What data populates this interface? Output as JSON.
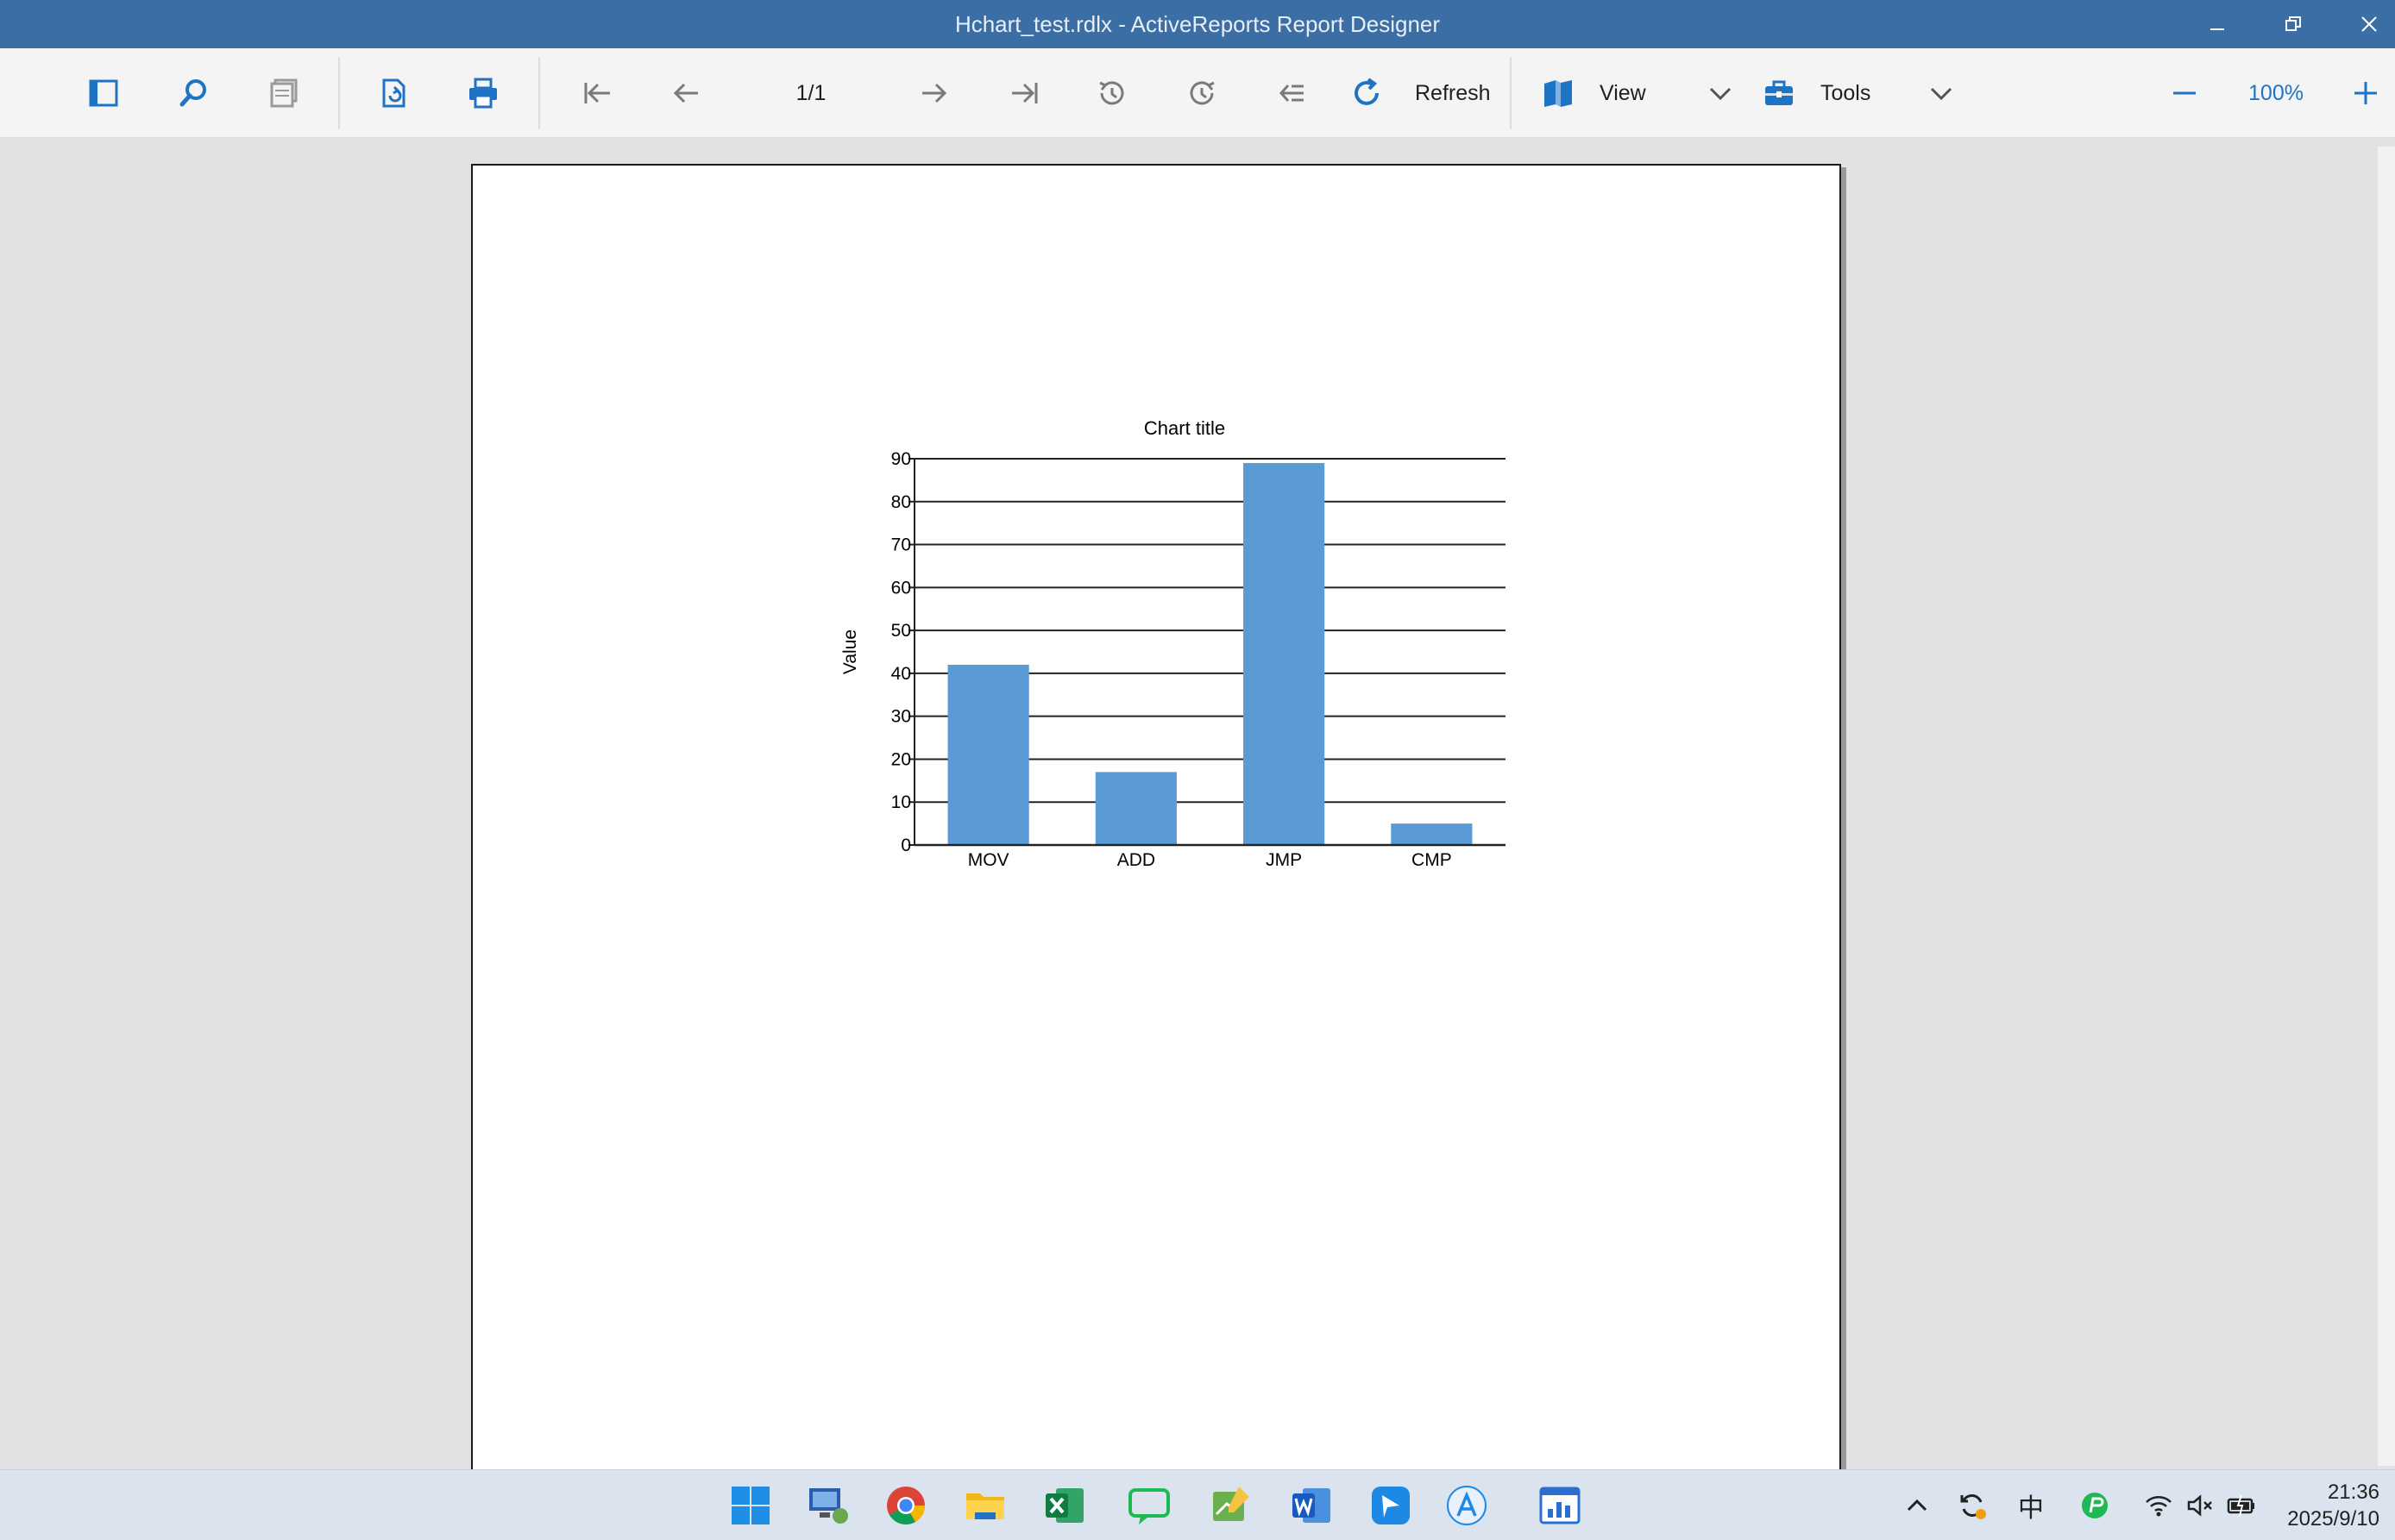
{
  "window": {
    "title": "Hchart_test.rdlx - ActiveReports Report Designer",
    "controls": [
      "minimize-icon",
      "restore-icon",
      "close-icon"
    ]
  },
  "toolbar": {
    "page_indicator": "1/1",
    "refresh_label": "Refresh",
    "view_label": "View",
    "tools_label": "Tools",
    "zoom_label": "100%",
    "icons": [
      "sidebar-toggle-icon",
      "search-icon",
      "pages-icon",
      "page-setup-icon",
      "print-icon",
      "first-page-icon",
      "previous-page-icon",
      "next-page-icon",
      "last-page-icon",
      "history-back-icon",
      "history-forward-icon",
      "back-to-parent-icon",
      "refresh-icon",
      "view-icon",
      "tools-icon",
      "zoom-out-icon",
      "zoom-in-icon"
    ],
    "accent_color": "#1f73c5"
  },
  "chart_data": {
    "type": "bar",
    "title": "Chart title",
    "xlabel": "",
    "ylabel": "Value",
    "categories": [
      "MOV",
      "ADD",
      "JMP",
      "CMP"
    ],
    "values": [
      42,
      17,
      89,
      5
    ],
    "ylim": [
      0,
      90
    ],
    "yticks": [
      "0",
      "10",
      "20",
      "30",
      "40",
      "50",
      "60",
      "70",
      "80",
      "90"
    ],
    "grid": true,
    "bar_color": "#5b9bd5"
  },
  "taskbar": {
    "apps": [
      "start-icon",
      "remote-desktop-icon",
      "chrome-icon",
      "file-explorer-icon",
      "excel-icon",
      "messaging-icon",
      "notes-icon",
      "word-icon",
      "feishu-icon",
      "app-store-icon",
      "report-designer-icon"
    ],
    "tray": {
      "ime_label": "中",
      "icons": [
        "chevron-up-icon",
        "sync-icon",
        "vpn-icon",
        "wifi-icon",
        "speaker-muted-icon",
        "battery-icon"
      ]
    },
    "clock_time": "21:36",
    "clock_date": "2025/9/10"
  }
}
